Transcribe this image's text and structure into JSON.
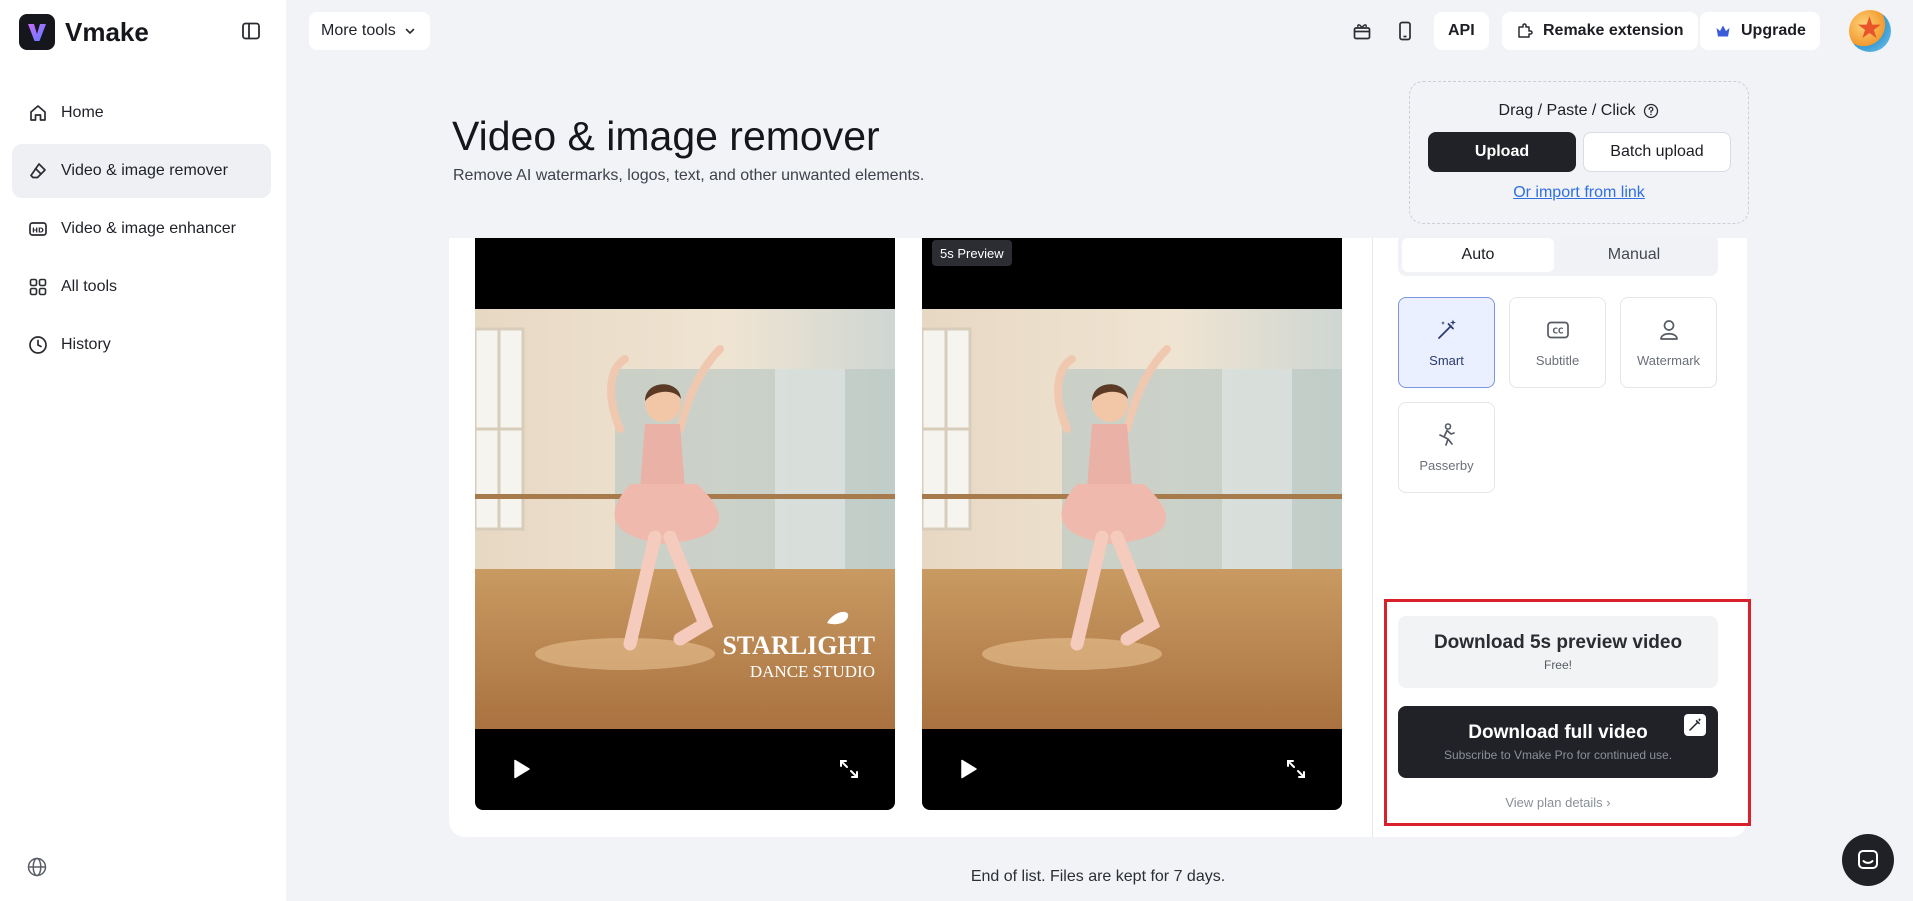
{
  "app": {
    "name": "Vmake"
  },
  "sidebar": {
    "items": [
      {
        "label": "Home",
        "icon": "home-icon"
      },
      {
        "label": "Video & image remover",
        "icon": "eraser-icon",
        "active": true
      },
      {
        "label": "Video & image enhancer",
        "icon": "hd-icon"
      },
      {
        "label": "All tools",
        "icon": "grid-icon"
      },
      {
        "label": "History",
        "icon": "clock-icon"
      }
    ]
  },
  "topbar": {
    "more_tools": "More tools",
    "api": "API",
    "remake_extension": "Remake extension",
    "upgrade": "Upgrade"
  },
  "header": {
    "title": "Video & image remover",
    "subtitle": "Remove AI watermarks, logos, text, and other unwanted elements."
  },
  "upload": {
    "label": "Drag / Paste / Click",
    "upload_button": "Upload",
    "batch_button": "Batch upload",
    "import_link": "Or import from link"
  },
  "videos": {
    "original_watermark_line1": "STARLIGHT",
    "original_watermark_line2": "DANCE STUDIO",
    "preview_badge": "5s Preview"
  },
  "panel": {
    "tabs": [
      "Auto",
      "Manual"
    ],
    "modes": [
      {
        "label": "Smart",
        "icon": "magic-wand-icon",
        "active": true
      },
      {
        "label": "Subtitle",
        "icon": "cc-icon"
      },
      {
        "label": "Watermark",
        "icon": "person-icon"
      },
      {
        "label": "Passerby",
        "icon": "walking-person-icon"
      }
    ],
    "download_preview": {
      "title": "Download 5s preview video",
      "sub": "Free!"
    },
    "download_full": {
      "title": "Download full video",
      "sub": "Subscribe to Vmake Pro for continued use."
    },
    "plan_link": "View plan details",
    "plan_link_chevron": "›"
  },
  "footer": {
    "end_of_list": "End of list. Files are kept for 7 days."
  },
  "colors": {
    "accent_dark": "#202227",
    "link": "#2f6fe0",
    "highlight_border": "#d8222b",
    "active_mode": "#eaf0ff"
  }
}
